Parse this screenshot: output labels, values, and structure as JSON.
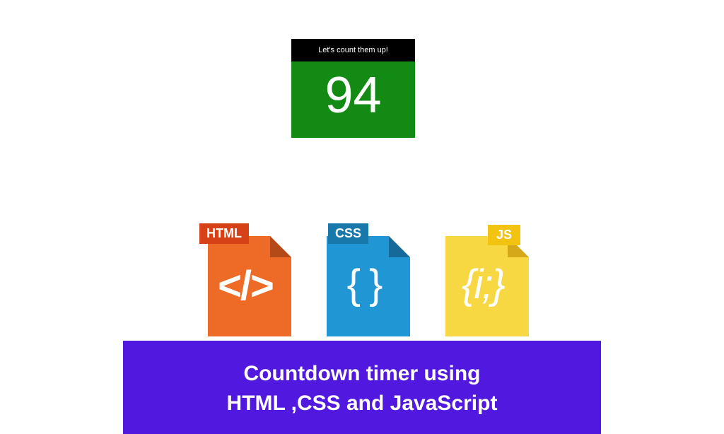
{
  "counter": {
    "title": "Let's count them up!",
    "value": "94"
  },
  "files": {
    "html": {
      "badge": "HTML",
      "symbol": "</>"
    },
    "css": {
      "badge": "CSS",
      "symbol": "{ }"
    },
    "js": {
      "badge": "JS",
      "symbol": "{i;}"
    }
  },
  "banner": {
    "line1": "Countdown timer using",
    "line2": "HTML ,CSS and JavaScript"
  }
}
